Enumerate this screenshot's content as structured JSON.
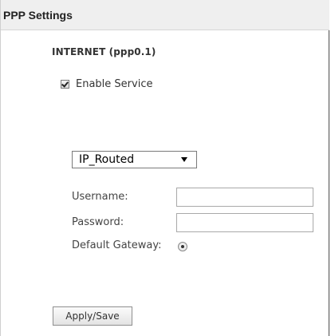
{
  "header": {
    "title": "PPP Settings"
  },
  "section": {
    "title": "INTERNET (ppp0.1)"
  },
  "enable_service": {
    "label": "Enable Service",
    "checked": true
  },
  "mode_select": {
    "selected": "IP_Routed"
  },
  "form": {
    "username_label": "Username:",
    "username_value": "",
    "password_label": "Password:",
    "password_value": "",
    "default_gateway_label": "Default Gateway:",
    "default_gateway_selected": true
  },
  "actions": {
    "apply_save_label": "Apply/Save"
  }
}
